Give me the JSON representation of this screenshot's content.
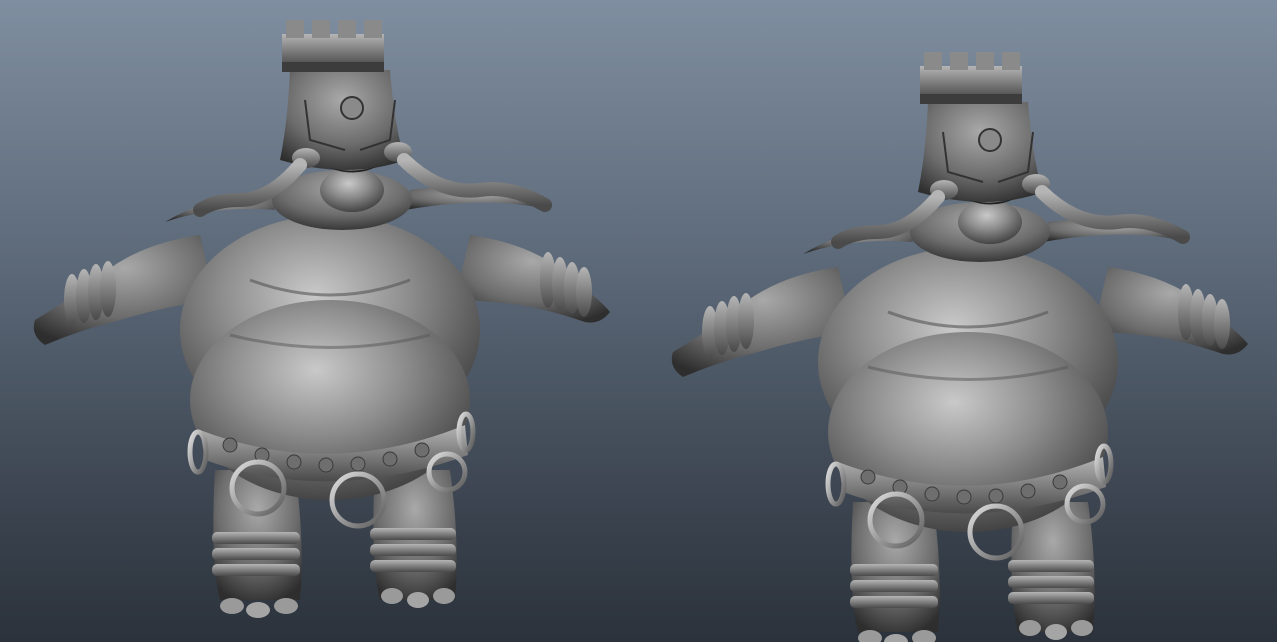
{
  "viewport": {
    "background_top": "#7f8ea0",
    "background_bottom": "#2b323b"
  },
  "models": [
    {
      "id": "left",
      "material": "lambert-gray"
    },
    {
      "id": "right",
      "material": "lambert-gray"
    }
  ]
}
